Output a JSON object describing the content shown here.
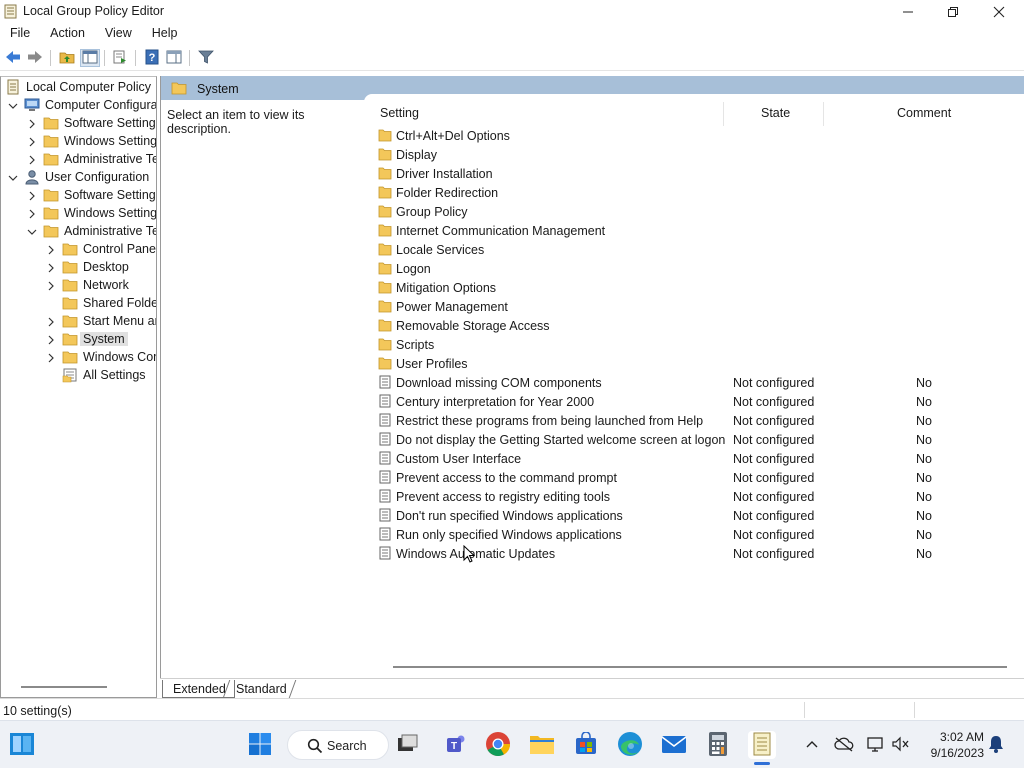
{
  "window": {
    "title": "Local Group Policy Editor"
  },
  "menubar": {
    "items": [
      "File",
      "Action",
      "View",
      "Help"
    ]
  },
  "tree": {
    "items": [
      {
        "label": "Local Computer Policy"
      },
      {
        "label": "Computer Configuration"
      },
      {
        "label": "Software Settings"
      },
      {
        "label": "Windows Settings"
      },
      {
        "label": "Administrative Templates"
      },
      {
        "label": "User Configuration"
      },
      {
        "label": "Software Settings"
      },
      {
        "label": "Windows Settings"
      },
      {
        "label": "Administrative Templates"
      },
      {
        "label": "Control Panel"
      },
      {
        "label": "Desktop"
      },
      {
        "label": "Network"
      },
      {
        "label": "Shared Folders"
      },
      {
        "label": "Start Menu and Taskbar"
      },
      {
        "label": "System"
      },
      {
        "label": "Windows Components"
      },
      {
        "label": "All Settings"
      }
    ]
  },
  "right": {
    "node_title": "System",
    "description": "Select an item to view its description.",
    "columns": {
      "setting": "Setting",
      "state": "State",
      "comment": "Comment"
    },
    "folders": [
      "Ctrl+Alt+Del Options",
      "Display",
      "Driver Installation",
      "Folder Redirection",
      "Group Policy",
      "Internet Communication Management",
      "Locale Services",
      "Logon",
      "Mitigation Options",
      "Power Management",
      "Removable Storage Access",
      "Scripts",
      "User Profiles"
    ],
    "settings": [
      {
        "name": "Download missing COM components",
        "state": "Not configured",
        "comment": "No"
      },
      {
        "name": "Century interpretation for Year 2000",
        "state": "Not configured",
        "comment": "No"
      },
      {
        "name": "Restrict these programs from being launched from Help",
        "state": "Not configured",
        "comment": "No"
      },
      {
        "name": "Do not display the Getting Started welcome screen at logon",
        "state": "Not configured",
        "comment": "No"
      },
      {
        "name": "Custom User Interface",
        "state": "Not configured",
        "comment": "No"
      },
      {
        "name": "Prevent access to the command prompt",
        "state": "Not configured",
        "comment": "No"
      },
      {
        "name": "Prevent access to registry editing tools",
        "state": "Not configured",
        "comment": "No"
      },
      {
        "name": "Don't run specified Windows applications",
        "state": "Not configured",
        "comment": "No"
      },
      {
        "name": "Run only specified Windows applications",
        "state": "Not configured",
        "comment": "No"
      },
      {
        "name": "Windows Automatic Updates",
        "state": "Not configured",
        "comment": "No"
      }
    ]
  },
  "tabs": {
    "extended": "Extended",
    "standard": "Standard"
  },
  "statusbar": {
    "text": "10 setting(s)"
  },
  "taskbar": {
    "search_label": "Search",
    "time": "3:02 AM",
    "date": "9/16/2023"
  },
  "colors": {
    "node_header": "#a7bfd8",
    "folder": "#f3c75a",
    "accent": "#2f6fd6"
  }
}
